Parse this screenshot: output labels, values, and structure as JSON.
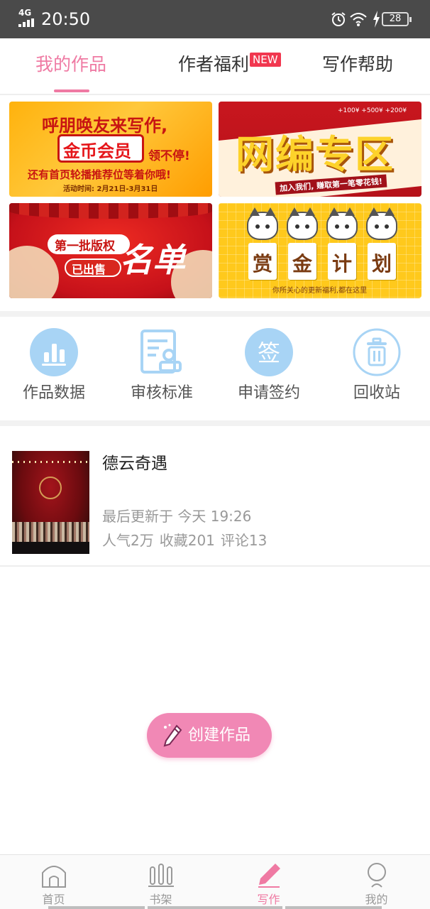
{
  "status_bar": {
    "network": "4G",
    "time": "20:50",
    "battery": "28"
  },
  "tabs": [
    {
      "label": "我的作品",
      "active": true
    },
    {
      "label": "作者福利",
      "badge": "NEW"
    },
    {
      "label": "写作帮助"
    }
  ],
  "banners": {
    "b1": {
      "line1": "呼朋唤友来写作,",
      "line2": "金币会员",
      "line3": "领不停!",
      "line4": "还有首页轮播推荐位等着你哦!",
      "line5": "活动时间: 2月21日-3月31日"
    },
    "b2": {
      "title": "网编专区",
      "sub": "加入我们, 赚取第一笔零花钱!",
      "coins": "+100¥ +500¥ +200¥"
    },
    "b3": {
      "line1": "第一批版权",
      "line2": "已出售",
      "line3": "名单"
    },
    "b4": {
      "chars": [
        "赏",
        "金",
        "计",
        "划"
      ],
      "sub": "你所关心的更新福利,都在这里"
    }
  },
  "actions": [
    {
      "label": "作品数据",
      "icon": "bar-chart-icon"
    },
    {
      "label": "审核标准",
      "icon": "document-stamp-icon"
    },
    {
      "label": "申请签约",
      "icon": "sign-icon",
      "glyph": "签"
    },
    {
      "label": "回收站",
      "icon": "trash-icon"
    }
  ],
  "work": {
    "title": "德云奇遇",
    "updated": "最后更新于 今天 19:26",
    "popularity": "人气2万",
    "favorites": "收藏201",
    "comments": "评论13"
  },
  "create_button": {
    "label": "创建作品"
  },
  "bottom_nav": [
    {
      "label": "首页",
      "icon": "home-icon"
    },
    {
      "label": "书架",
      "icon": "bookshelf-icon"
    },
    {
      "label": "写作",
      "icon": "pencil-icon",
      "active": true
    },
    {
      "label": "我的",
      "icon": "profile-icon"
    }
  ],
  "colors": {
    "accent": "#ef7aa3",
    "button": "#f188b5",
    "badge": "#f1374f",
    "action_icon": "#a8d4f5"
  }
}
